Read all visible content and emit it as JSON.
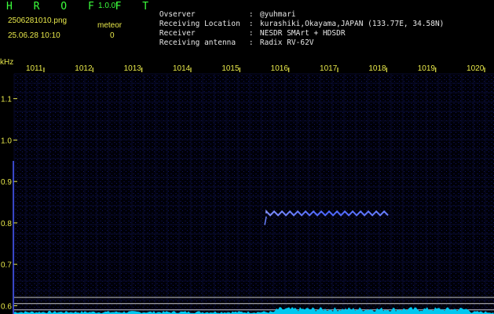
{
  "header": {
    "app_title": "H R O F F T",
    "version": "1.0.0f",
    "file_name": "2506281010.png",
    "mode": "meteor",
    "timestamp": "25.06.28 10:10",
    "count": "0"
  },
  "station_info": [
    {
      "label": "Ovserver",
      "value": "@yuhmari"
    },
    {
      "label": "Receiving Location",
      "value": "kurashiki,Okayama,JAPAN (133.77E, 34.58N)"
    },
    {
      "label": "Receiver",
      "value": "NESDR SMArt + HDSDR"
    },
    {
      "label": "Receiving antenna",
      "value": "Radix RV-62V"
    }
  ],
  "colors": {
    "header_green": "#3cff3c",
    "axis_yellow": "#e8e84a",
    "info_white": "#e6e6e6",
    "background": "#000000",
    "signal_blue": "#5a78ff",
    "noise_cyan": "#00d8ff"
  },
  "chart_data": {
    "type": "heatmap",
    "y_unit_label": "kHz",
    "x_tick_labels": [
      "1011",
      "1012",
      "1013",
      "1014",
      "1015",
      "1016",
      "1017",
      "1018",
      "1019",
      "1020"
    ],
    "y_tick_labels": [
      "1.1",
      "1.0",
      "0.9",
      "0.8",
      "0.7",
      "0.6"
    ],
    "y_ticks": [
      1.1,
      1.0,
      0.9,
      0.8,
      0.7,
      0.6
    ],
    "ylim": [
      0.58,
      1.16
    ],
    "xlim": [
      1010.6,
      1020.4
    ],
    "reference_lines_khz": [
      0.62,
      0.605,
      0.59
    ],
    "meteor_echo": {
      "x_start": 1015.75,
      "x_end": 1018.3,
      "freq_khz": 0.823,
      "head_freq_khz": 0.795
    }
  }
}
